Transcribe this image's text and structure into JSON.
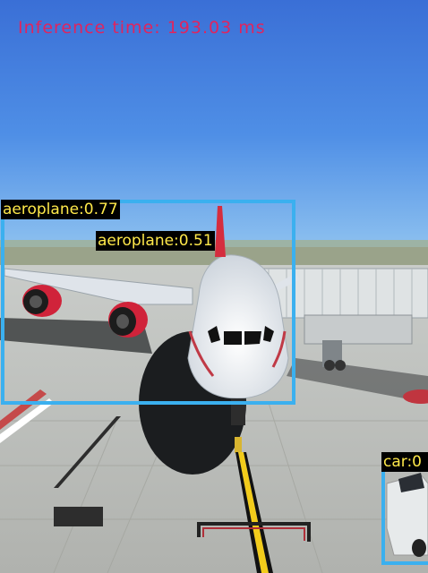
{
  "overlay": {
    "inference_text": "Inference time: 193.03 ms"
  },
  "detections": [
    {
      "label": "aeroplane:0.77"
    },
    {
      "label": "aeroplane:0.51"
    },
    {
      "label": "car:0"
    }
  ],
  "colors": {
    "box": "#3bb0ef",
    "label_text": "#ffe94a",
    "label_bg": "#000000",
    "inference_text": "#e0245e"
  }
}
